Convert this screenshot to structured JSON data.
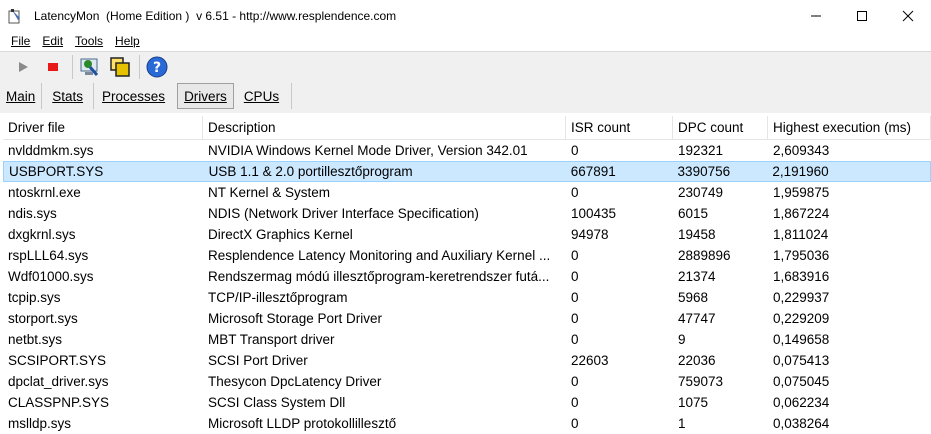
{
  "window": {
    "title": "LatencyMon  (Home Edition )  v 6.51 - http://www.resplendence.com"
  },
  "menu": [
    {
      "label": "File"
    },
    {
      "label": "Edit"
    },
    {
      "label": "Tools"
    },
    {
      "label": "Help"
    }
  ],
  "toolbar": [
    {
      "name": "start-icon",
      "color": "#8a8a8a"
    },
    {
      "name": "stop-icon",
      "color": "#e81818"
    },
    {
      "name": "monitor-icon",
      "color": "#2a8a2a"
    },
    {
      "name": "windows-icon",
      "color": "#e6c200"
    },
    {
      "name": "help-icon",
      "color": "#2a6ad6"
    }
  ],
  "tabs": [
    {
      "label": "Main",
      "active": false
    },
    {
      "label": "Stats",
      "active": false
    },
    {
      "label": "Processes",
      "active": false
    },
    {
      "label": "Drivers",
      "active": true
    },
    {
      "label": "CPUs",
      "active": false
    }
  ],
  "table": {
    "columns": [
      "Driver file",
      "Description",
      "ISR count",
      "DPC count",
      "Highest execution (ms)"
    ],
    "rows": [
      [
        "nvlddmkm.sys",
        "NVIDIA Windows Kernel Mode Driver, Version 342.01",
        "0",
        "192321",
        "2,609343"
      ],
      [
        "USBPORT.SYS",
        "USB 1.1 & 2.0 portillesztőprogram",
        "667891",
        "3390756",
        "2,191960"
      ],
      [
        "ntoskrnl.exe",
        "NT Kernel & System",
        "0",
        "230749",
        "1,959875"
      ],
      [
        "ndis.sys",
        "NDIS (Network Driver Interface Specification)",
        "100435",
        "6015",
        "1,867224"
      ],
      [
        "dxgkrnl.sys",
        "DirectX Graphics Kernel",
        "94978",
        "19458",
        "1,811024"
      ],
      [
        "rspLLL64.sys",
        "Resplendence Latency Monitoring and Auxiliary Kernel ...",
        "0",
        "2889896",
        "1,795036"
      ],
      [
        "Wdf01000.sys",
        "Rendszermag módú illesztőprogram-keretrendszer futá...",
        "0",
        "21374",
        "1,683916"
      ],
      [
        "tcpip.sys",
        "TCP/IP-illesztőprogram",
        "0",
        "5968",
        "0,229937"
      ],
      [
        "storport.sys",
        "Microsoft Storage Port Driver",
        "0",
        "47747",
        "0,229209"
      ],
      [
        "netbt.sys",
        "MBT Transport driver",
        "0",
        "9",
        "0,149658"
      ],
      [
        "SCSIPORT.SYS",
        "SCSI Port Driver",
        "22603",
        "22036",
        "0,075413"
      ],
      [
        "dpclat_driver.sys",
        "Thesycon DpcLatency Driver",
        "0",
        "759073",
        "0,075045"
      ],
      [
        "CLASSPNP.SYS",
        "SCSI Class System Dll",
        "0",
        "1075",
        "0,062234"
      ],
      [
        "mslldp.sys",
        "Microsoft LLDP protokollillesztő",
        "0",
        "1",
        "0,038264"
      ]
    ],
    "selected_row": 1,
    "selection_color": "#cce8ff"
  }
}
